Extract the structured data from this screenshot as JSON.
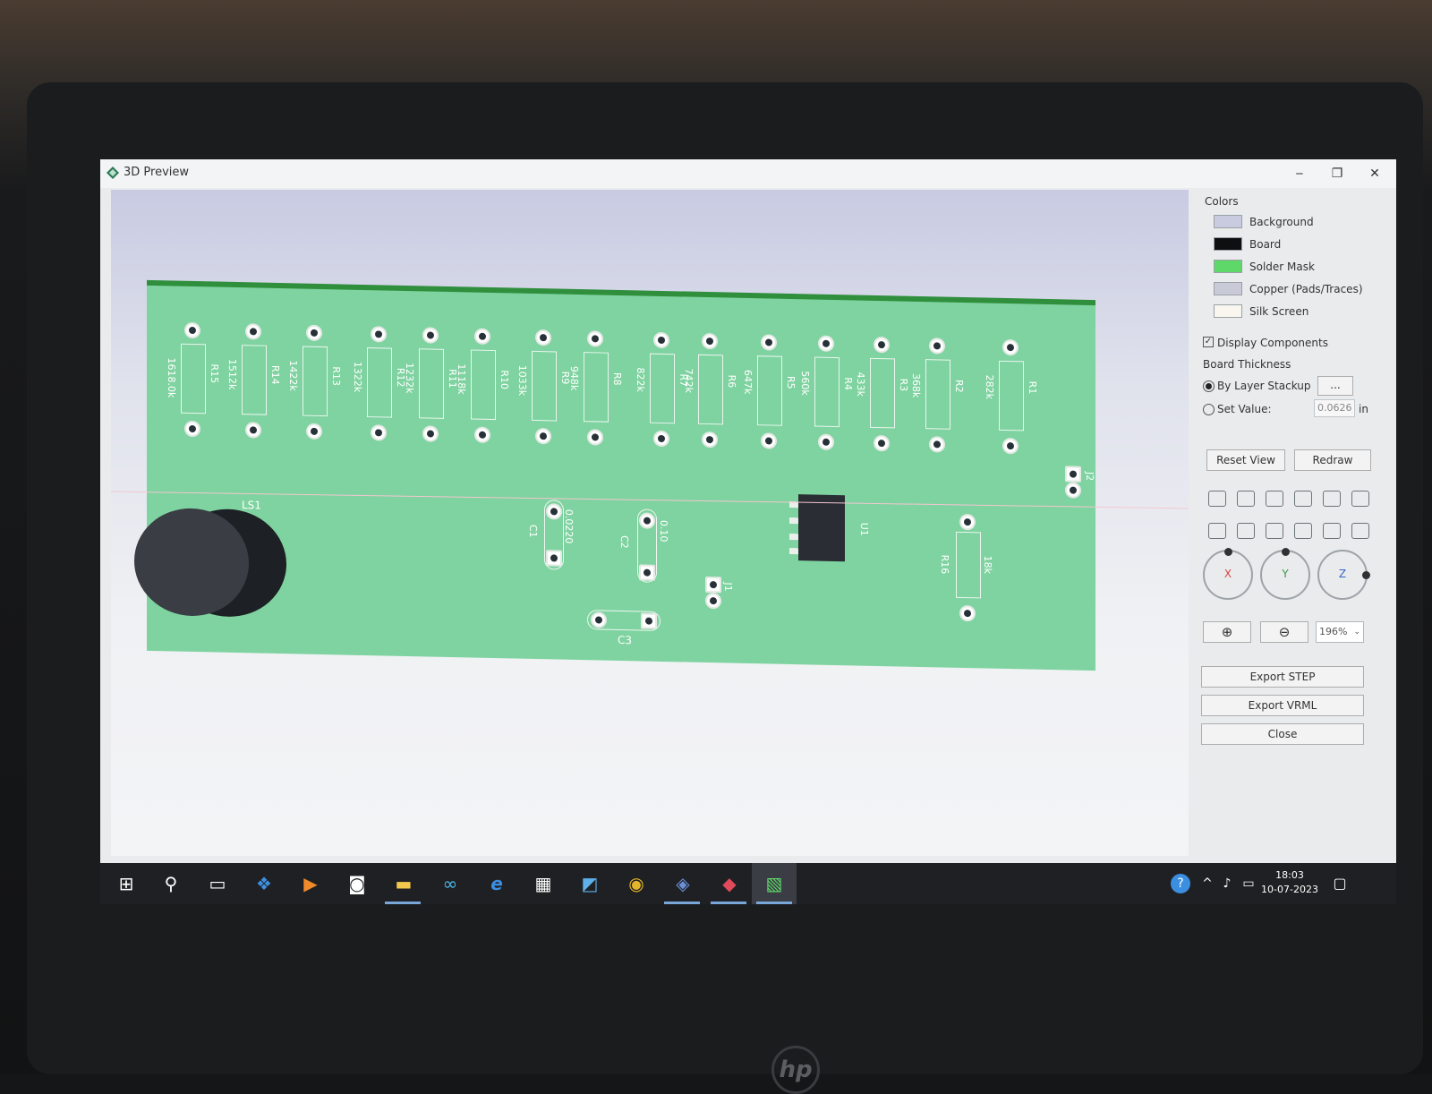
{
  "window": {
    "title": "3D Preview",
    "minimize": "‒",
    "restore": "❐",
    "close": "✕"
  },
  "board": {
    "resistors": [
      {
        "ref": "R15",
        "value": "1618.0k"
      },
      {
        "ref": "R14",
        "value": "1512k"
      },
      {
        "ref": "R13",
        "value": "1422k"
      },
      {
        "ref": "R12",
        "value": "1322k"
      },
      {
        "ref": "R11",
        "value": "1232k"
      },
      {
        "ref": "R10",
        "value": "1118k"
      },
      {
        "ref": "R9",
        "value": "1033k"
      },
      {
        "ref": "R8",
        "value": "948k"
      },
      {
        "ref": "R7",
        "value": "822k"
      },
      {
        "ref": "R6",
        "value": "742k"
      },
      {
        "ref": "R5",
        "value": "647k"
      },
      {
        "ref": "R4",
        "value": "560k"
      },
      {
        "ref": "R3",
        "value": "433k"
      },
      {
        "ref": "R2",
        "value": "368k"
      },
      {
        "ref": "R1",
        "value": "282k"
      }
    ],
    "other_labels": {
      "ls1": "LS1",
      "u1": "U1",
      "j2": "J2",
      "c1": "C1",
      "c1_value": "0.0220",
      "c2": "C2",
      "c2_value": "0.10",
      "c3": "C3",
      "r16": "R16",
      "r16_value": "18k",
      "j1": "J1"
    }
  },
  "panel": {
    "colors_title": "Colors",
    "colors": [
      {
        "label": "Background",
        "color": "#c9cbe0"
      },
      {
        "label": "Board",
        "color": "#0d0f10"
      },
      {
        "label": "Solder Mask",
        "color": "#5fd86a"
      },
      {
        "label": "Copper (Pads/Traces)",
        "color": "#c8cad8"
      },
      {
        "label": "Silk Screen",
        "color": "#f8f6ee"
      }
    ],
    "display_components": "Display Components",
    "board_thickness": "Board Thickness",
    "by_layer_stackup": "By Layer Stackup",
    "ellipsis": "...",
    "set_value": "Set Value:",
    "thickness_value": "0.0626",
    "thickness_unit": "in",
    "reset_view": "Reset View",
    "redraw": "Redraw",
    "axis_x": "X",
    "axis_y": "Y",
    "axis_z": "Z",
    "zoom_in_glyph": "⊕",
    "zoom_out_glyph": "⊖",
    "zoom_level": "196%",
    "export_step": "Export STEP",
    "export_vrml": "Export VRML",
    "close": "Close"
  },
  "taskbar": {
    "start_glyph": "⊞",
    "search_glyph": "⚲",
    "taskview_glyph": "▭",
    "dropbox_glyph": "❖",
    "media_glyph": "▶",
    "camera_glyph": "◙",
    "explorer_glyph": "▬",
    "infinity_glyph": "∞",
    "edge_glyph": "e",
    "calc_glyph": "▦",
    "remote_glyph": "◩",
    "chrome_glyph": "◉",
    "app1_glyph": "◈",
    "app2_glyph": "◆",
    "app3_glyph": "▧",
    "tray_help_glyph": "?",
    "tray_up_glyph": "^",
    "tray_sound_glyph": "♪",
    "tray_battery_glyph": "▭",
    "time": "18:03",
    "date": "10-07-2023",
    "notify_glyph": "▢"
  }
}
